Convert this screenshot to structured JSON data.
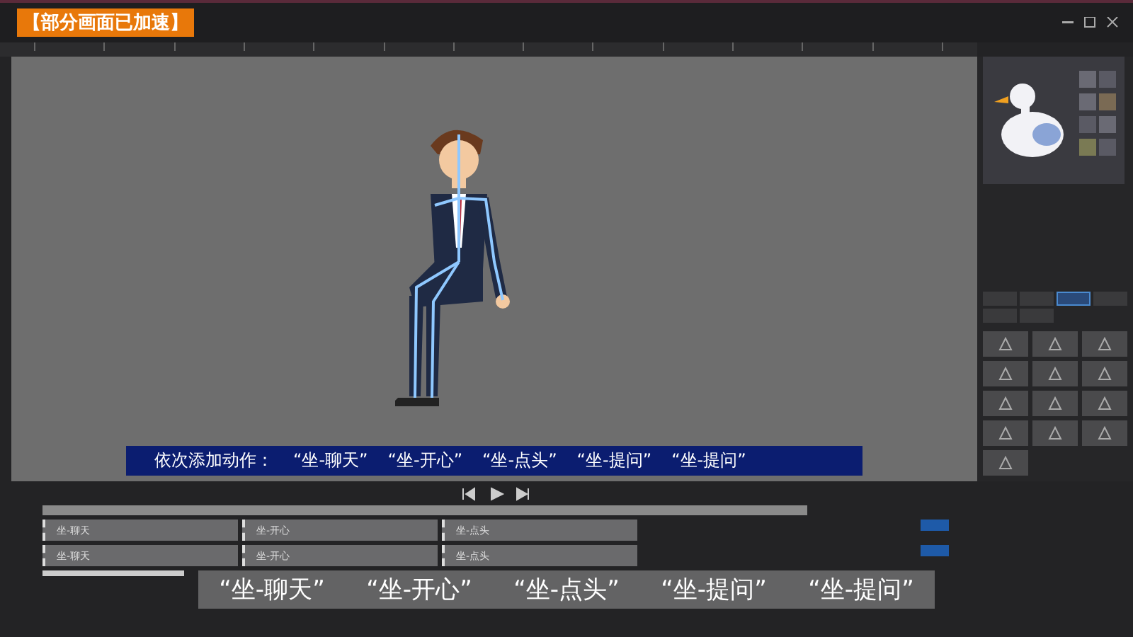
{
  "badge": "【部分画面已加速】",
  "banner": {
    "label": "依次添加动作：",
    "items": [
      "“坐-聊天”",
      "“坐-开心”",
      "“坐-点头”",
      "“坐-提问”",
      "“坐-提问”"
    ]
  },
  "categories": [
    {
      "selected": false
    },
    {
      "selected": false
    },
    {
      "selected": true
    },
    {
      "selected": false
    },
    {
      "selected": false
    },
    {
      "selected": false
    }
  ],
  "tracks": [
    {
      "clips": [
        "坐-聊天",
        "坐-开心",
        "坐-点头"
      ]
    },
    {
      "clips": [
        "坐-聊天",
        "坐-开心",
        "坐-点头"
      ]
    }
  ],
  "subtitle": [
    "“坐-聊天”",
    "“坐-开心”",
    "“坐-点头”",
    "“坐-提问”",
    "“坐-提问”"
  ]
}
